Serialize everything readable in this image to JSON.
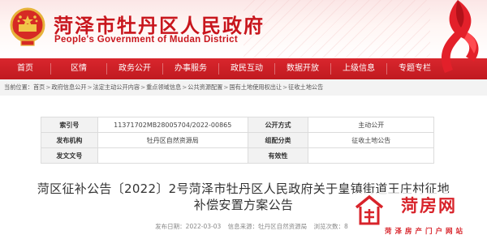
{
  "header": {
    "title": "菏泽市牡丹区人民政府",
    "subtitle": "People's Government of Mudan District"
  },
  "nav": {
    "items": [
      "首页",
      "区情",
      "政务公开",
      "办事服务",
      "政民互动",
      "数据开放",
      "上级信息",
      "专题专栏"
    ]
  },
  "breadcrumb": {
    "prefix": "当前位置：",
    "items": [
      "首页",
      "政府信息公开",
      "法定主动公开内容",
      "重点领域信息",
      "公共资源配置",
      "国有土地使用权出让",
      "征收土地公告"
    ],
    "separator": ">"
  },
  "meta_table": {
    "rows": [
      {
        "label1": "索引号",
        "value1": "11371702MB28005704/2022-00865",
        "label2": "公开方式",
        "value2": "主动公开"
      },
      {
        "label1": "发布机构",
        "value1": "牡丹区自然资源局",
        "label2": "组配分类",
        "value2": "征收土地公告"
      },
      {
        "label1": "发文文号",
        "value1": "",
        "label2": "有效性",
        "value2": ""
      }
    ]
  },
  "article": {
    "title": "菏区征补公告〔2022〕2号菏泽市牡丹区人民政府关于皇镇街道王庄村征地补偿安置方案公告",
    "publish_date": "发布日期：2022-03-03",
    "source": "信息来源：牡丹区自然资源局",
    "views": "浏览次数：8"
  },
  "watermark": {
    "text": "菏房网",
    "subtext": "菏泽房产门户网站"
  },
  "colors": {
    "brand_red": "#c8161d",
    "nav_red": "#d0222a"
  }
}
